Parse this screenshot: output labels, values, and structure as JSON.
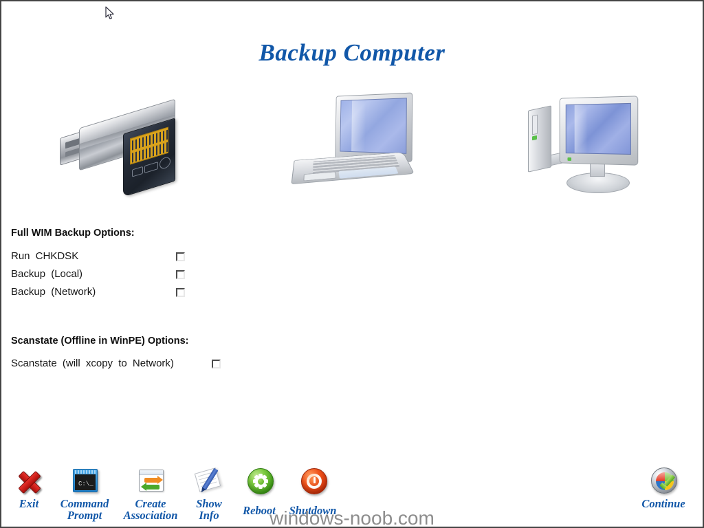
{
  "window": {
    "title": "Backup Computer",
    "accent_color": "#1157a8",
    "background_color": "#ffffff",
    "border_color": "#444444"
  },
  "illustrations": [
    {
      "name": "usb-flash-drive-with-memory-card",
      "alt": "USB flash drive and memory card"
    },
    {
      "name": "laptop-computer",
      "alt": "Laptop computer"
    },
    {
      "name": "desktop-computer",
      "alt": "Desktop computer with monitor"
    }
  ],
  "groups": {
    "wim": {
      "header": "Full WIM Backup Options:",
      "options": [
        {
          "label": "Run  CHKDSK",
          "checked": false
        },
        {
          "label": "Backup  (Local)",
          "checked": false
        },
        {
          "label": "Backup  (Network)",
          "checked": false
        }
      ]
    },
    "scanstate": {
      "header": "Scanstate (Offline in WinPE) Options:",
      "options": [
        {
          "label": "Scanstate  (will  xcopy  to  Network)",
          "checked": false
        }
      ]
    }
  },
  "toolbar": {
    "exit": {
      "label": "Exit",
      "icon": "red-x-icon"
    },
    "command_prompt": {
      "label_line1": "Command",
      "label_line2": "Prompt",
      "icon": "command-prompt-icon",
      "icon_text": "C:\\_"
    },
    "create_association": {
      "label_line1": "Create",
      "label_line2": "Association",
      "icon": "create-association-icon"
    },
    "show_info": {
      "label_line1": "Show",
      "label_line2": "Info",
      "icon": "notepad-pen-icon"
    },
    "reboot": {
      "label": "Reboot",
      "icon": "reboot-icon"
    },
    "shutdown": {
      "label": "Shutdown",
      "icon": "shutdown-power-icon"
    },
    "continue": {
      "label": "Continue",
      "icon": "windows-orb-check-icon"
    }
  },
  "watermark": "windows-noob.com"
}
